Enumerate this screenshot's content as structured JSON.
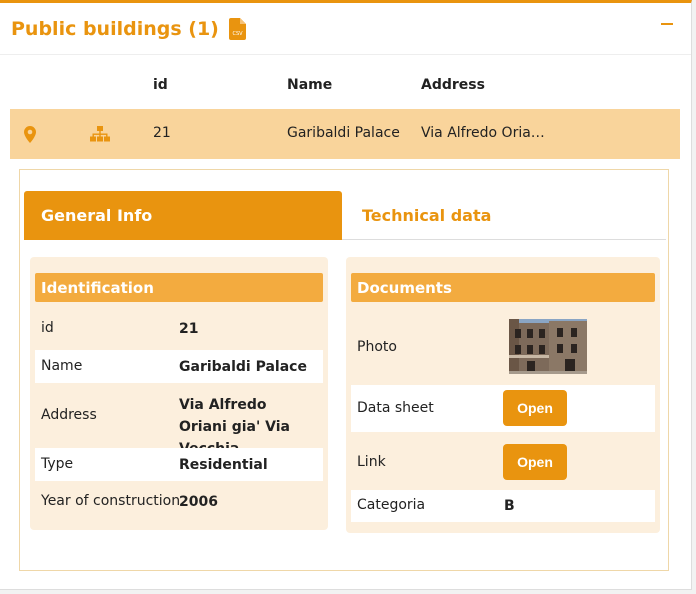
{
  "panel": {
    "title": "Public buildings (1)",
    "csv_icon_text": "CSV"
  },
  "table": {
    "headers": {
      "id": "id",
      "name": "Name",
      "address": "Address"
    },
    "row": {
      "id": "21",
      "name": "Garibaldi Palace",
      "address": "Via Alfredo Oria…"
    }
  },
  "tabs": [
    {
      "label": "General Info",
      "active": true
    },
    {
      "label": "Technical data",
      "active": false
    }
  ],
  "identification": {
    "title": "Identification",
    "fields": [
      {
        "key": "id",
        "value": "21"
      },
      {
        "key": "Name",
        "value": "Garibaldi Palace"
      },
      {
        "key": "Address",
        "value": "Via Alfredo Oriani gia' Via Vecchia"
      },
      {
        "key": "Type",
        "value": "Residential"
      },
      {
        "key": "Year of construction",
        "value": "2006"
      }
    ]
  },
  "documents": {
    "title": "Documents",
    "photo_label": "Photo",
    "datasheet_label": "Data sheet",
    "datasheet_button": "Open",
    "link_label": "Link",
    "link_button": "Open",
    "categoria_label": "Categoria",
    "categoria_value": "B"
  },
  "colors": {
    "accent": "#e9940f",
    "selected_row": "#f9d49b",
    "card_bg": "#fcefdd",
    "card_header": "#f3ab3f"
  }
}
